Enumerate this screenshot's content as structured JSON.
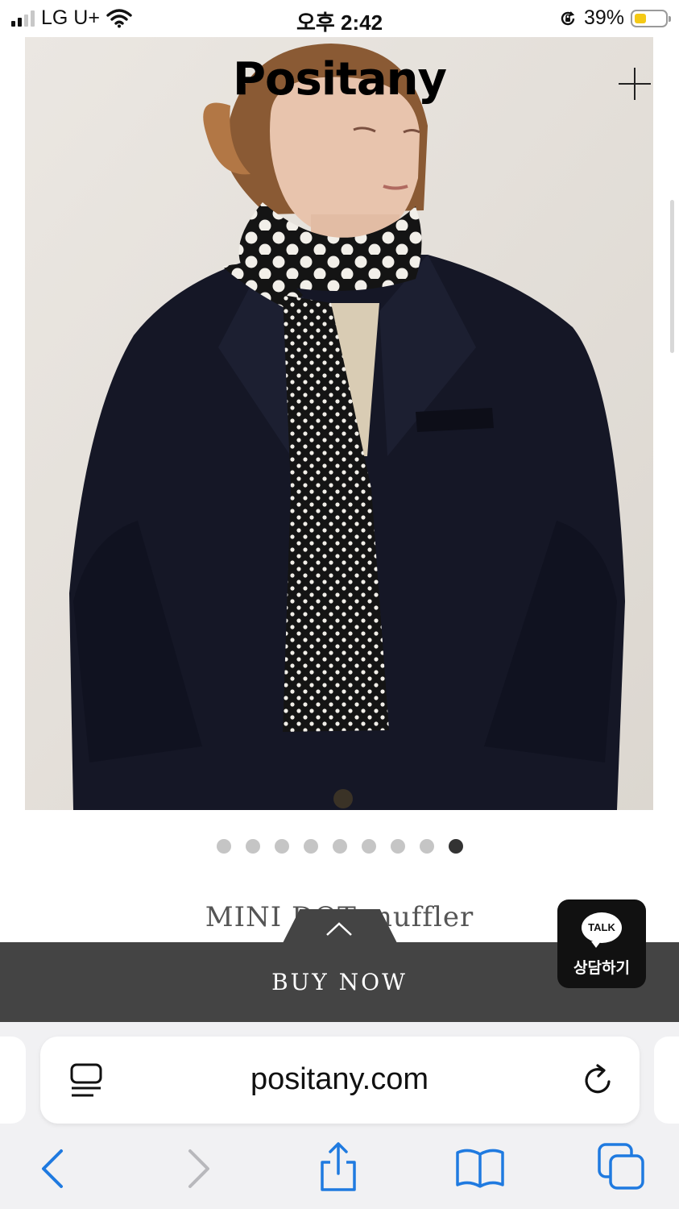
{
  "status_bar": {
    "carrier": "LG U+",
    "time": "오후 2:42",
    "battery": "39%"
  },
  "site": {
    "brand": "Positany",
    "product_name": "MINI DOT muffler",
    "carousel": {
      "total": 9,
      "active_index": 9
    },
    "buy_now": "BUY NOW",
    "talk_badge": "TALK",
    "talk_label": "상담하기"
  },
  "browser": {
    "url": "positany.com"
  },
  "colors": {
    "buy_bar": "#444444",
    "browser_accent": "#1f7ae0",
    "battery": "#f4c916"
  }
}
